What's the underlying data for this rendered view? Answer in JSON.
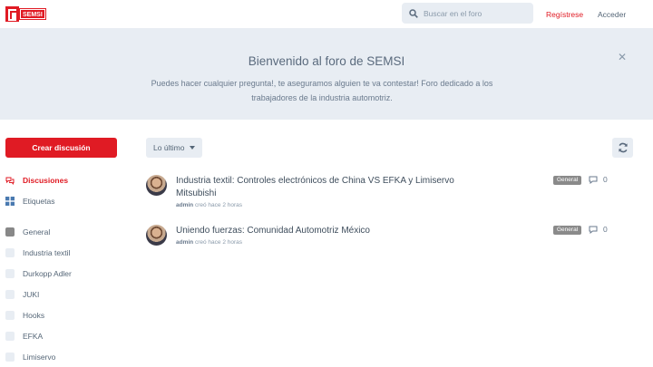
{
  "header": {
    "logo_text": "SEMSI",
    "search_placeholder": "Buscar en el foro",
    "signup_label": "Regístrese",
    "login_label": "Acceder"
  },
  "hero": {
    "title": "Bienvenido al foro de SEMSI",
    "description": "Puedes hacer cualquier pregunta!, te aseguramos alguien te va contestar! Foro dedicado a los trabajadores de la industria automotriz."
  },
  "sidebar": {
    "start_discussion_label": "Crear discusión",
    "nav": [
      {
        "label": "Discusiones",
        "icon": "comments-icon",
        "active": true
      },
      {
        "label": "Etiquetas",
        "icon": "tags-icon",
        "active": false
      }
    ],
    "tags": [
      "General",
      "Industria textil",
      "Durkopp Adler",
      "JUKI",
      "Hooks",
      "EFKA",
      "Limiservo"
    ]
  },
  "toolbar": {
    "sort_label": "Lo último"
  },
  "discussions": [
    {
      "title": "Industria textil: Controles electrónicos de China VS EFKA y Limiservo Mitsubishi",
      "author": "admin",
      "meta": "creó hace 2 horas",
      "tag": "General",
      "replies": "0"
    },
    {
      "title": "Uniendo fuerzas: Comunidad Automotriz México",
      "author": "admin",
      "meta": "creó hace 2 horas",
      "tag": "General",
      "replies": "0"
    }
  ],
  "colors": {
    "accent": "#e01b24",
    "hero_bg": "#e8edf3",
    "tag_general": "#8a8a8a"
  }
}
